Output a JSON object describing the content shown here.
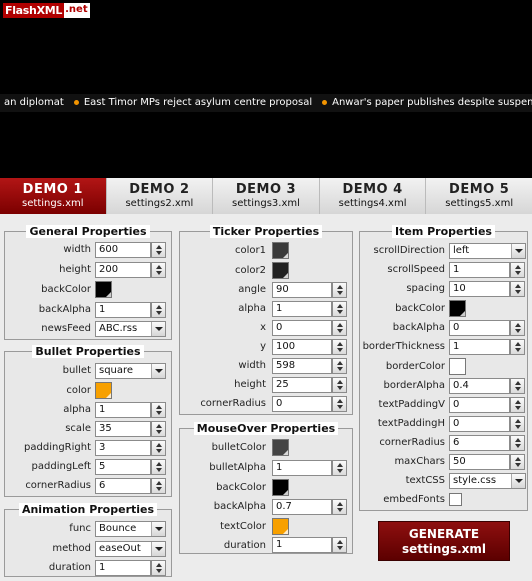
{
  "logo": {
    "part1": "FlashXML",
    "part2": ".net"
  },
  "ticker": {
    "items": [
      {
        "text": "an diplomat",
        "bullet": false
      },
      {
        "text": "East Timor MPs reject asylum centre proposal",
        "bullet": true
      },
      {
        "text": "Anwar's paper publishes despite suspen",
        "bullet": true
      }
    ]
  },
  "tabs": [
    {
      "title": "DEMO 1",
      "sub": "settings.xml",
      "active": true
    },
    {
      "title": "DEMO 2",
      "sub": "settings2.xml",
      "active": false
    },
    {
      "title": "DEMO 3",
      "sub": "settings3.xml",
      "active": false
    },
    {
      "title": "DEMO 4",
      "sub": "settings4.xml",
      "active": false
    },
    {
      "title": "DEMO 5",
      "sub": "settings5.xml",
      "active": false
    }
  ],
  "general": {
    "title": "General Properties",
    "width": {
      "label": "width",
      "value": "600"
    },
    "height": {
      "label": "height",
      "value": "200"
    },
    "backColor": {
      "label": "backColor",
      "color": "#000000"
    },
    "backAlpha": {
      "label": "backAlpha",
      "value": "1"
    },
    "newsFeed": {
      "label": "newsFeed",
      "value": "ABC.rss"
    }
  },
  "bullet": {
    "title": "Bullet Properties",
    "bullet": {
      "label": "bullet",
      "value": "square"
    },
    "color": {
      "label": "color",
      "color": "#f7a000"
    },
    "alpha": {
      "label": "alpha",
      "value": "1"
    },
    "scale": {
      "label": "scale",
      "value": "35"
    },
    "paddingRight": {
      "label": "paddingRight",
      "value": "3"
    },
    "paddingLeft": {
      "label": "paddingLeft",
      "value": "5"
    },
    "cornerRadius": {
      "label": "cornerRadius",
      "value": "6"
    }
  },
  "animation": {
    "title": "Animation Properties",
    "func": {
      "label": "func",
      "value": "Bounce"
    },
    "method": {
      "label": "method",
      "value": "easeOut"
    },
    "duration": {
      "label": "duration",
      "value": "1"
    }
  },
  "tickerProps": {
    "title": "Ticker Properties",
    "color1": {
      "label": "color1",
      "color": "#3a3a3a"
    },
    "color2": {
      "label": "color2",
      "color": "#222222"
    },
    "angle": {
      "label": "angle",
      "value": "90"
    },
    "alpha": {
      "label": "alpha",
      "value": "1"
    },
    "x": {
      "label": "x",
      "value": "0"
    },
    "y": {
      "label": "y",
      "value": "100"
    },
    "width": {
      "label": "width",
      "value": "598"
    },
    "height": {
      "label": "height",
      "value": "25"
    },
    "cornerRadius": {
      "label": "cornerRadius",
      "value": "0"
    }
  },
  "mouseover": {
    "title": "MouseOver Properties",
    "bulletColor": {
      "label": "bulletColor",
      "color": "#444444"
    },
    "bulletAlpha": {
      "label": "bulletAlpha",
      "value": "1"
    },
    "backColor": {
      "label": "backColor",
      "color": "#000000"
    },
    "backAlpha": {
      "label": "backAlpha",
      "value": "0.7"
    },
    "textColor": {
      "label": "textColor",
      "color": "#f7a000"
    },
    "duration": {
      "label": "duration",
      "value": "1"
    }
  },
  "item": {
    "title": "Item Properties",
    "scrollDirection": {
      "label": "scrollDirection",
      "value": "left"
    },
    "scrollSpeed": {
      "label": "scrollSpeed",
      "value": "1"
    },
    "spacing": {
      "label": "spacing",
      "value": "10"
    },
    "backColor": {
      "label": "backColor",
      "color": "#000000"
    },
    "backAlpha": {
      "label": "backAlpha",
      "value": "0"
    },
    "borderThickness": {
      "label": "borderThickness",
      "value": "1"
    },
    "borderColor": {
      "label": "borderColor",
      "color": "#ffffff"
    },
    "borderAlpha": {
      "label": "borderAlpha",
      "value": "0.4"
    },
    "textPaddingV": {
      "label": "textPaddingV",
      "value": "0"
    },
    "textPaddingH": {
      "label": "textPaddingH",
      "value": "0"
    },
    "cornerRadius": {
      "label": "cornerRadius",
      "value": "6"
    },
    "maxChars": {
      "label": "maxChars",
      "value": "50"
    },
    "textCSS": {
      "label": "textCSS",
      "value": "style.css"
    },
    "embedFonts": {
      "label": "embedFonts",
      "checked": false
    }
  },
  "generate": {
    "line1": "GENERATE",
    "line2": "settings.xml"
  }
}
